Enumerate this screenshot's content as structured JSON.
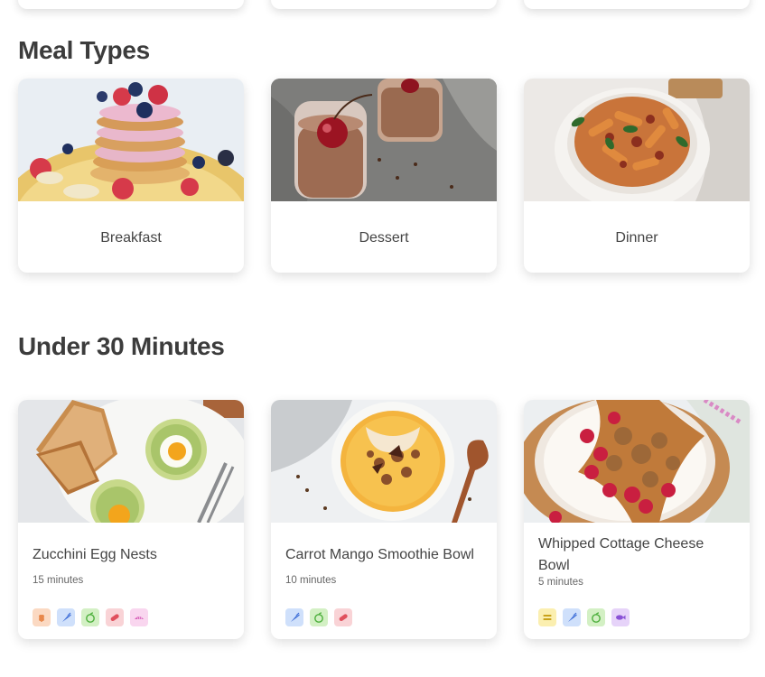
{
  "sections": {
    "meal_types": {
      "title": "Meal Types",
      "cards": [
        {
          "label": "Breakfast",
          "image": "pancakes-with-berries"
        },
        {
          "label": "Dessert",
          "image": "chocolate-mousse-with-cherry"
        },
        {
          "label": "Dinner",
          "image": "pasta-bowl"
        }
      ]
    },
    "under_30": {
      "title": "Under 30 Minutes",
      "recipes": [
        {
          "title": "Zucchini Egg Nests",
          "time": "15 minutes",
          "image": "zucchini-egg-nests-with-toast",
          "tags": [
            {
              "icon": "wheat-icon",
              "bg": "#fbd9c2",
              "fg": "#e8874a"
            },
            {
              "icon": "carrot-icon",
              "bg": "#cfe0fb",
              "fg": "#3f6fd8"
            },
            {
              "icon": "apple-icon",
              "bg": "#d3f0c4",
              "fg": "#4caf3c"
            },
            {
              "icon": "sausage-icon",
              "bg": "#f9d3d6",
              "fg": "#e0505c"
            },
            {
              "icon": "bread-icon",
              "bg": "#f9d6ef",
              "fg": "#d65bb7"
            }
          ]
        },
        {
          "title": "Carrot Mango Smoothie Bowl",
          "time": "10 minutes",
          "image": "mango-smoothie-bowl-with-granola",
          "tags": [
            {
              "icon": "carrot-icon",
              "bg": "#cfe0fb",
              "fg": "#3f6fd8"
            },
            {
              "icon": "apple-icon",
              "bg": "#d3f0c4",
              "fg": "#4caf3c"
            },
            {
              "icon": "sausage-icon",
              "bg": "#f9d3d6",
              "fg": "#e0505c"
            }
          ]
        },
        {
          "title": "Whipped Cottage Cheese Bowl",
          "time": "5 minutes",
          "image": "cottage-cheese-bowl-with-raspberries",
          "tags": [
            {
              "icon": "cheese-icon",
              "bg": "#fbefb0",
              "fg": "#c9a21a"
            },
            {
              "icon": "carrot-icon",
              "bg": "#cfe0fb",
              "fg": "#3f6fd8"
            },
            {
              "icon": "apple-icon",
              "bg": "#d3f0c4",
              "fg": "#4caf3c"
            },
            {
              "icon": "fish-icon",
              "bg": "#e6d3f9",
              "fg": "#8a52d6"
            }
          ]
        }
      ]
    }
  }
}
